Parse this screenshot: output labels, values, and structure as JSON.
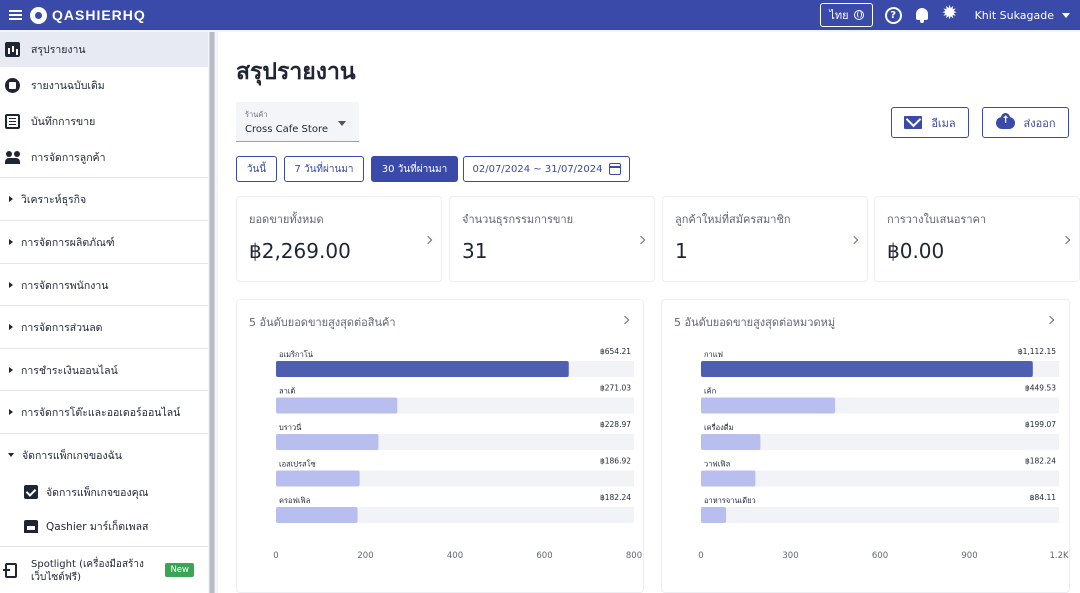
{
  "header": {
    "brand": "QASHIERHQ",
    "language": "ไทย",
    "user_name": "Khit Sukagade"
  },
  "sidebar": {
    "items": [
      {
        "label": "สรุปรายงาน",
        "icon": "bar-chart-icon",
        "active": true
      },
      {
        "label": "รายงานฉบับเดิม",
        "icon": "classic-report-icon"
      },
      {
        "label": "บันทึกการขาย",
        "icon": "list-icon"
      },
      {
        "label": "การจัดการลูกค้า",
        "icon": "people-icon"
      },
      {
        "label": "วิเคราะห์ธุรกิจ",
        "icon": "expand-right-icon"
      },
      {
        "label": "การจัดการผลิตภัณฑ์",
        "icon": "expand-right-icon"
      },
      {
        "label": "การจัดการพนักงาน",
        "icon": "expand-right-icon"
      },
      {
        "label": "การจัดการส่วนลด",
        "icon": "expand-right-icon"
      },
      {
        "label": "การชำระเงินออนไลน์",
        "icon": "expand-right-icon"
      },
      {
        "label": "การจัดการโต๊ะและออเดอร์ออนไลน์",
        "icon": "expand-right-icon"
      },
      {
        "label": "จัดการแพ็กเกจของฉัน",
        "icon": "expand-down-icon"
      },
      {
        "label": "จัดการแพ็กเกจของคุณ",
        "icon": "checkbox-icon"
      },
      {
        "label": "Qashier มาร์เก็ตเพลส",
        "icon": "store-icon"
      }
    ],
    "spotlight": {
      "label_line1": "Spotlight (เครื่องมือสร้าง",
      "label_line2": "เว็บไซต์ฟรี)",
      "badge": "New"
    }
  },
  "main": {
    "title": "สรุปรายงาน",
    "store_select": {
      "label": "ร้านค้า",
      "value": "Cross Cafe Store"
    },
    "email_button": "อีเมล",
    "export_button": "ส่งออก",
    "date_ranges": [
      "วันนี้",
      "7 วันที่ผ่านมา",
      "30 วันที่ผ่านมา"
    ],
    "selected_range": "30 วันที่ผ่านมา",
    "date_picker": "02/07/2024 ~ 31/07/2024",
    "stats": [
      {
        "label": "ยอดขายทั้งหมด",
        "value": "฿2,269.00"
      },
      {
        "label": "จำนวนธุรกรรมการขาย",
        "value": "31"
      },
      {
        "label": "ลูกค้าใหม่ที่สมัครสมาชิก",
        "value": "1"
      },
      {
        "label": "การวางใบเสนอราคา",
        "value": "฿0.00"
      }
    ]
  },
  "colors": {
    "brand": "#3a4aa8",
    "bar_primary": "#4f5fb0",
    "bar_secondary": "#b8bfee"
  },
  "chart_data": [
    {
      "type": "bar",
      "orientation": "horizontal",
      "title": "5 อันดับยอดขายสูงสุดต่อสินค้า",
      "categories": [
        "อเมริกาโน่",
        "ลาเต้",
        "บราวนี่",
        "เอสเปรสโซ",
        "ครอฟเฟิล"
      ],
      "values": [
        654.21,
        271.03,
        228.97,
        186.92,
        182.24
      ],
      "value_labels": [
        "฿654.21",
        "฿271.03",
        "฿228.97",
        "฿186.92",
        "฿182.24"
      ],
      "xlim": [
        0,
        800
      ],
      "ticks": [
        "0",
        "200",
        "400",
        "600",
        "800"
      ],
      "tick_values": [
        0,
        200,
        400,
        600,
        800
      ]
    },
    {
      "type": "bar",
      "orientation": "horizontal",
      "title": "5 อันดับยอดขายสูงสุดต่อหมวดหมู่",
      "categories": [
        "กาแฟ",
        "เค้ก",
        "เครื่องดื่ม",
        "วาฟเฟิล",
        "อาหารจานเดียว"
      ],
      "values": [
        1112.15,
        449.53,
        199.07,
        182.24,
        84.11
      ],
      "value_labels": [
        "฿1,112.15",
        "฿449.53",
        "฿199.07",
        "฿182.24",
        "฿84.11"
      ],
      "xlim": [
        0,
        1200
      ],
      "ticks": [
        "0",
        "300",
        "600",
        "900",
        "1.2K"
      ],
      "tick_values": [
        0,
        300,
        600,
        900,
        1200
      ]
    }
  ]
}
